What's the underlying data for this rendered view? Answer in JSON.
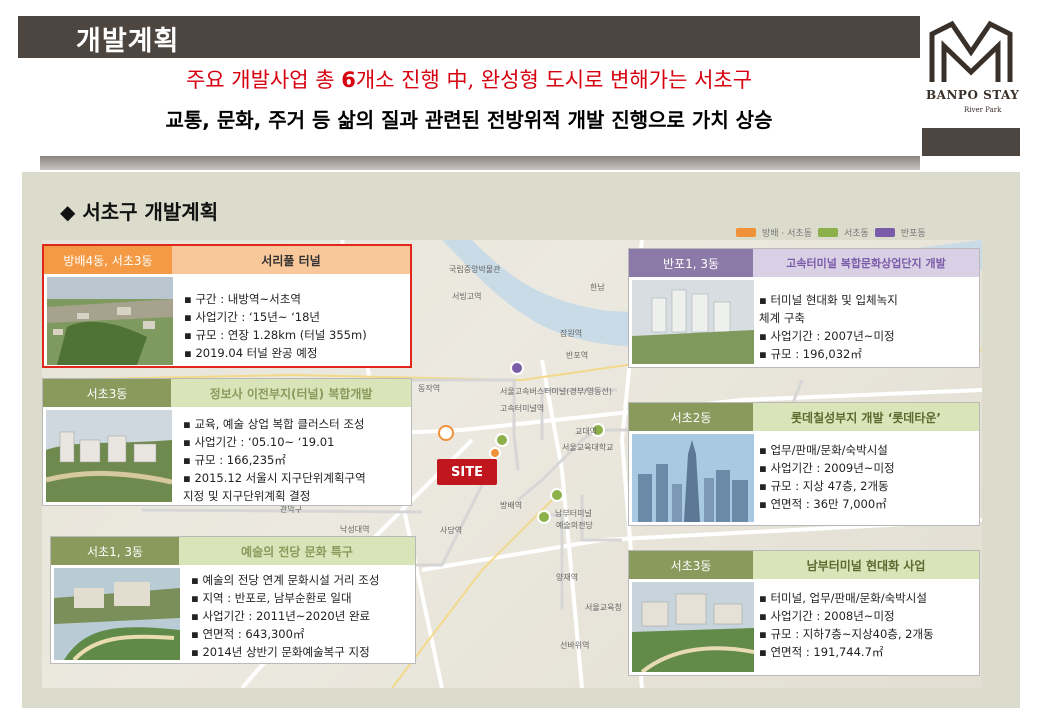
{
  "header": {
    "title": "개발계획",
    "headline_red_pre": "주요 개발사업 총 ",
    "headline_red_num": "6",
    "headline_red_post": "개소 진행 中, 완성형 도시로 변해가는 서초구",
    "headline_black": "교통, 문화, 주거 등 삶의 질과 관련된 전방위적 개발 진행으로 가치 상승"
  },
  "logo": {
    "name": "BANPO STAY",
    "sub": "River Park"
  },
  "section": {
    "title": "◆ 서초구 개발계획"
  },
  "legend": [
    {
      "label": "방배 · 서초동",
      "color": "#f0923a"
    },
    {
      "label": "서초동",
      "color": "#8cb04a"
    },
    {
      "label": "반포동",
      "color": "#7b5ca8"
    }
  ],
  "colors": {
    "orange": "#f0923a",
    "green": "#8cb04a",
    "purple": "#7b5ca8",
    "red": "#e1261c",
    "head_orange_bg": "#f49a44",
    "head_green_bg": "#d9e5b8",
    "head_purple_bg": "#d9d0e6"
  },
  "site_label": "SITE",
  "map_labels": [
    "국립중앙박물관",
    "서빙고역",
    "한남",
    "잠원역",
    "반포역",
    "동작역",
    "서울고속버스터미널(경부/영동선)",
    "고속터미널역",
    "서울교육대학교",
    "교대역",
    "방배역",
    "남부터미널",
    "예술의전당",
    "관악구",
    "낙성대역",
    "사당역",
    "양재역",
    "선바위역",
    "서울교육청",
    "강남대로"
  ],
  "projects": [
    {
      "location": "방배4동, 서초3동",
      "name": "서리풀 터널",
      "items": [
        "구간 : 내방역~서초역",
        "사업기간 : ‘15년~ ‘18년",
        "규모 : 연장 1.28km (터널 355m)",
        "2019.04 터널 완공 예정"
      ]
    },
    {
      "location": "서초3동",
      "name": "정보사 이전부지(터널) 복합개발",
      "items": [
        "교육, 예술 상업 복합 클러스터 조성",
        "사업기간 : ‘05.10~ ‘19.01",
        "규모 : 166,235㎡",
        "2015.12 서울시 지구단위계획구역",
        "지정 및 지구단위계획 결정"
      ]
    },
    {
      "location": "서초1, 3동",
      "name": "예술의 전당 문화 특구",
      "items": [
        "예술의 전당 연계 문화시설 거리 조성",
        "지역 : 반포로, 남부순환로 일대",
        "사업기간 : 2011년~2020년 완료",
        "연면적 : 643,300㎡",
        "2014년 상반기 문화예술복구 지정"
      ]
    },
    {
      "location": "반포1, 3동",
      "name": "고속터미널 복합문화상업단지 개발",
      "items": [
        "터미널 현대화 및 입체녹지",
        "체계 구축",
        "사업기간 : 2007년~미정",
        "규모 : 196,032㎡"
      ]
    },
    {
      "location": "서초2동",
      "name": "롯데칠성부지 개발 ‘롯데타운’",
      "items": [
        "업무/판매/문화/숙박시설",
        "사업기간 : 2009년~미정",
        "규모 : 지상 47층, 2개동",
        "연면적 : 36만 7,000㎡"
      ]
    },
    {
      "location": "서초3동",
      "name": "남부터미널 현대화 사업",
      "items": [
        "터미널, 업무/판매/문화/숙박시설",
        "사업기간 : 2008년~미정",
        "규모 : 지하7층~지상40층, 2개동",
        "연면적 : 191,744.7㎡"
      ]
    }
  ]
}
